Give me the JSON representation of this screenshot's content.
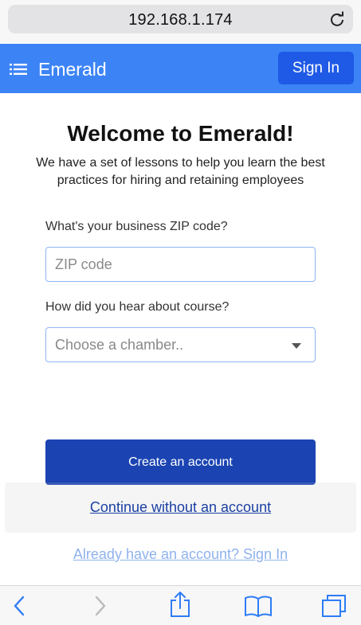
{
  "browser": {
    "url": "192.168.1.174",
    "reload_icon": "reload-icon",
    "toolbar_icons": [
      "back-icon",
      "forward-icon",
      "share-icon",
      "bookmarks-icon",
      "tabs-icon"
    ]
  },
  "header": {
    "menu_icon": "hamburger-menu-icon",
    "brand": "Emerald",
    "sign_in_label": "Sign In"
  },
  "main": {
    "title": "Welcome to Emerald!",
    "subtitle": "We have a set of lessons to help you learn the best practices for hiring and retaining employees",
    "zip_label": "What's your business ZIP code?",
    "zip_placeholder": "ZIP code",
    "heard_label": "How did you hear about course?",
    "heard_selected": "Choose a chamber..",
    "create_account_label": "Create an account",
    "continue_link": "Continue without an account",
    "already_link": "Already have an account? Sign In"
  },
  "colors": {
    "header_bg": "#3c84f6",
    "sign_in_bg": "#1f5ae6",
    "primary_button": "#1b44b2",
    "link": "#1b3fa3",
    "faded_link": "#8fb2ee"
  }
}
